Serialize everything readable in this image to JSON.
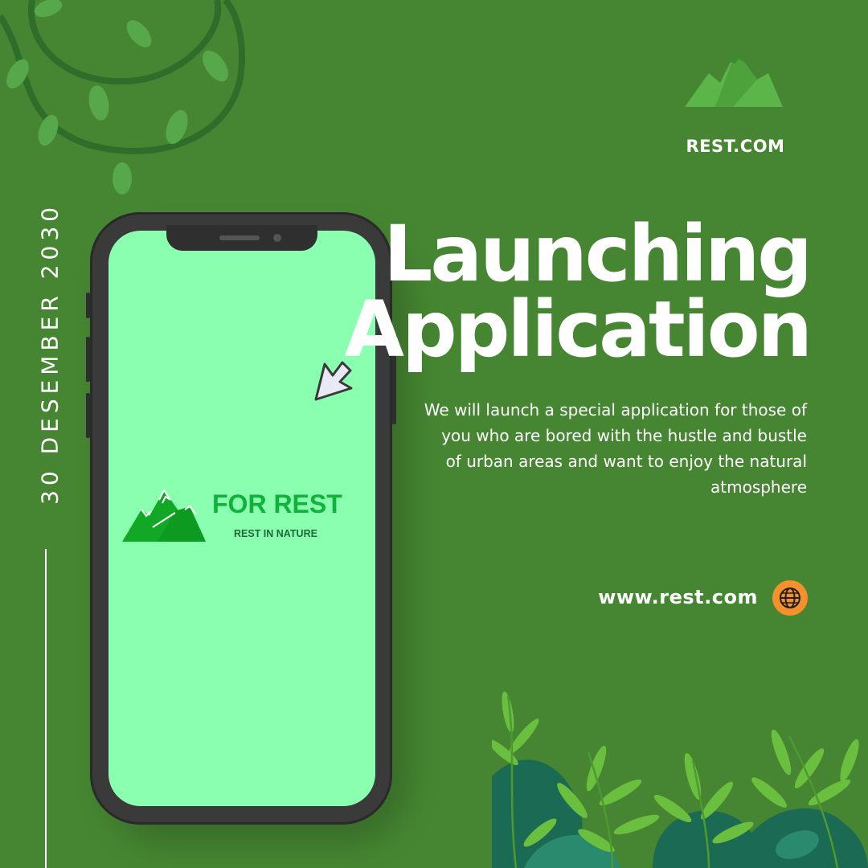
{
  "brand": {
    "name": "REST.COM",
    "logo_icon": "mountain-icon"
  },
  "date": "30 DESEMBER 2030",
  "headline": {
    "line1": "Launching",
    "line2": "Application"
  },
  "description": "We will launch a special application for those of you who are bored with the hustle and bustle of urban areas and want to enjoy the natural atmosphere",
  "website": {
    "url": "www.rest.com",
    "icon": "globe-icon"
  },
  "phone_screen": {
    "app_title": "FOR REST",
    "app_tagline": "REST IN NATURE",
    "logo_icon": "mountain-icon",
    "cursor_icon": "cursor-arrow-icon"
  },
  "colors": {
    "background": "#468632",
    "screen": "#8bffb0",
    "app_title": "#11b23b",
    "globe_accent": "#f4912c",
    "logo_mountain": "#5cb548"
  }
}
